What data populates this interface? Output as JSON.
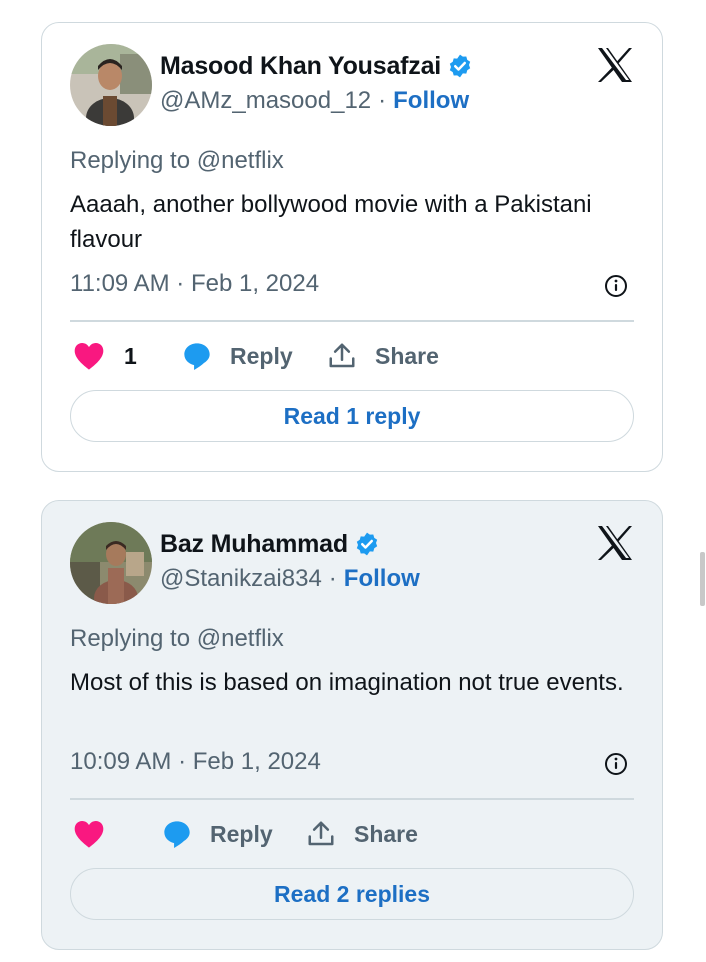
{
  "tweets": [
    {
      "display_name": "Masood Khan Yousafzai",
      "handle": "@AMz_masood_12",
      "separator": "·",
      "follow_label": "Follow",
      "replying_to": "Replying to @netflix",
      "text": "Aaaah, another bollywood movie with a Pakistani flavour",
      "timestamp": "11:09 AM · Feb 1, 2024",
      "like_count": "1",
      "reply_label": "Reply",
      "share_label": "Share",
      "read_replies_label": "Read 1 reply"
    },
    {
      "display_name": "Baz Muhammad",
      "handle": "@Stanikzai834",
      "separator": "·",
      "follow_label": "Follow",
      "replying_to": "Replying to @netflix",
      "text": "Most of this is based on imagination not true events.",
      "timestamp": "10:09 AM · Feb 1, 2024",
      "like_count": "",
      "reply_label": "Reply",
      "share_label": "Share",
      "read_replies_label": "Read 2 replies"
    }
  ],
  "icons": {
    "brand_logo": "x-logo-icon",
    "verified": "verified-badge-icon",
    "info": "info-icon",
    "like": "heart-icon",
    "reply": "speech-bubble-icon",
    "share": "share-upload-icon"
  },
  "colors": {
    "like_heart": "#f91880",
    "reply_bubble": "#1d9bf0",
    "verified_badge": "#1d9bf0",
    "follow_link": "#1d6fc4",
    "secondary_text": "#536471",
    "primary_text": "#0f1419",
    "card_border": "#cfd9de",
    "card_2_background": "#edf2f5"
  }
}
